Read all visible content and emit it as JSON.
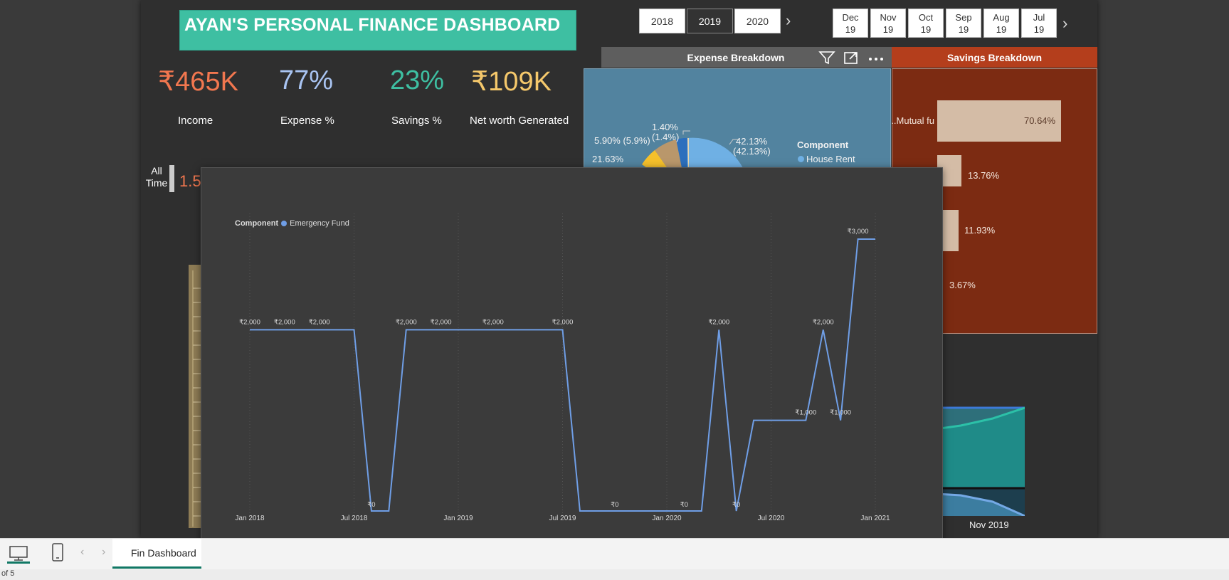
{
  "dashboard": {
    "title": "AYAN'S PERSONAL FINANCE DASHBOARD",
    "kpis": [
      {
        "value": "₹465K",
        "label": "Income",
        "color": "#f2774f"
      },
      {
        "value": "77%",
        "label": "Expense %",
        "color": "#a9c4f2"
      },
      {
        "value": "23%",
        "label": "Savings %",
        "color": "#3ebfa2"
      },
      {
        "value": "₹109K",
        "label": "Net worth Generated",
        "color": "#f5c86b"
      }
    ],
    "all_time_label": "All Time",
    "all_time_value": "1.5",
    "years": [
      "2018",
      "2019",
      "2020"
    ],
    "selected_year": "2019",
    "months": [
      {
        "month": "Dec",
        "year": "19"
      },
      {
        "month": "Nov",
        "year": "19"
      },
      {
        "month": "Oct",
        "year": "19"
      },
      {
        "month": "Sep",
        "year": "19"
      },
      {
        "month": "Aug",
        "year": "19"
      },
      {
        "month": "Jul",
        "year": "19"
      }
    ]
  },
  "expense_breakdown": {
    "title": "Expense Breakdown",
    "legend_title": "Component",
    "legend_item": "House Rent",
    "labels": {
      "a": "1.40%",
      "a2": "(1.4%)",
      "b": "5.90% (5.9%)",
      "c": "21.63%",
      "d": "42.13%",
      "d2": "(42.13%)"
    },
    "colors": {
      "house_rent": "#6fb0e4",
      "blue": "#2c6fbd",
      "tan": "#b9976b",
      "yellow": "#f5c02b"
    }
  },
  "savings_breakdown": {
    "title": "Savings Breakdown",
    "row1_label": "Mutual fu...",
    "values": [
      "70.64%",
      "13.76%",
      "11.93%",
      "3.67%"
    ]
  },
  "area_chart": {
    "x_label": "Nov 2019"
  },
  "popup": {
    "legend_title": "Component",
    "legend_item": "Emergency Fund",
    "line_color": "#6f9ee6"
  },
  "chart_data": {
    "type": "line",
    "title": "",
    "xlabel": "",
    "ylabel": "",
    "x_ticks": [
      "Jan 2018",
      "Jul 2018",
      "Jan 2019",
      "Jul 2019",
      "Jan 2020",
      "Jul 2020",
      "Jan 2021"
    ],
    "series": [
      {
        "name": "Emergency Fund",
        "x": [
          "2018-01",
          "2018-02",
          "2018-03",
          "2018-04",
          "2018-05",
          "2018-06",
          "2018-07",
          "2018-08",
          "2018-09",
          "2018-10",
          "2018-11",
          "2018-12",
          "2019-01",
          "2019-02",
          "2019-03",
          "2019-04",
          "2019-05",
          "2019-06",
          "2019-07",
          "2019-08",
          "2019-09",
          "2019-10",
          "2019-11",
          "2019-12",
          "2020-01",
          "2020-02",
          "2020-03",
          "2020-04",
          "2020-05",
          "2020-06",
          "2020-07",
          "2020-08",
          "2020-09",
          "2020-10",
          "2020-11",
          "2020-12",
          "2021-01"
        ],
        "values": [
          2000,
          2000,
          2000,
          2000,
          2000,
          2000,
          2000,
          0,
          0,
          2000,
          2000,
          2000,
          2000,
          2000,
          2000,
          2000,
          2000,
          2000,
          2000,
          0,
          0,
          0,
          0,
          0,
          0,
          0,
          0,
          2000,
          0,
          1000,
          1000,
          1000,
          1000,
          2000,
          1000,
          3000,
          3000
        ],
        "labels": [
          {
            "x": "2018-01",
            "text": "₹2,000"
          },
          {
            "x": "2018-03",
            "text": "₹2,000"
          },
          {
            "x": "2018-05",
            "text": "₹2,000"
          },
          {
            "x": "2018-08",
            "text": "₹0"
          },
          {
            "x": "2018-10",
            "text": "₹2,000"
          },
          {
            "x": "2018-12",
            "text": "₹2,000"
          },
          {
            "x": "2019-03",
            "text": "₹2,000"
          },
          {
            "x": "2019-07",
            "text": "₹2,000"
          },
          {
            "x": "2019-10",
            "text": "₹0"
          },
          {
            "x": "2020-02",
            "text": "₹0"
          },
          {
            "x": "2020-04",
            "text": "₹2,000"
          },
          {
            "x": "2020-05",
            "text": "₹0"
          },
          {
            "x": "2020-09",
            "text": "₹1,000"
          },
          {
            "x": "2020-10",
            "text": "₹2,000"
          },
          {
            "x": "2020-11",
            "text": "₹1,000"
          },
          {
            "x": "2020-12",
            "text": "₹3,000"
          }
        ]
      }
    ],
    "ylim": [
      0,
      3000
    ],
    "grid": "vertical-dotted",
    "legend": "top-left"
  },
  "bottom": {
    "tab": "Fin Dashboard",
    "status": "of 5"
  }
}
